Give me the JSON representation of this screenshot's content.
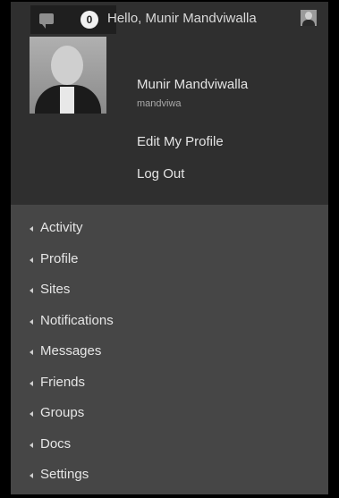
{
  "topbar": {
    "notification_count": "0",
    "greeting": "Hello, Munir Mandviwalla"
  },
  "profile": {
    "name": "Munir Mandviwalla",
    "username": "mandviwa",
    "edit_label": "Edit My Profile",
    "logout_label": "Log Out"
  },
  "menu": {
    "items": [
      {
        "label": "Activity"
      },
      {
        "label": "Profile"
      },
      {
        "label": "Sites"
      },
      {
        "label": "Notifications"
      },
      {
        "label": "Messages"
      },
      {
        "label": "Friends"
      },
      {
        "label": "Groups"
      },
      {
        "label": "Docs"
      },
      {
        "label": "Settings"
      }
    ]
  },
  "colors": {
    "topbar_bg": "#2f2f2f",
    "menu_bg": "#464646",
    "text": "#e4e4e4"
  }
}
